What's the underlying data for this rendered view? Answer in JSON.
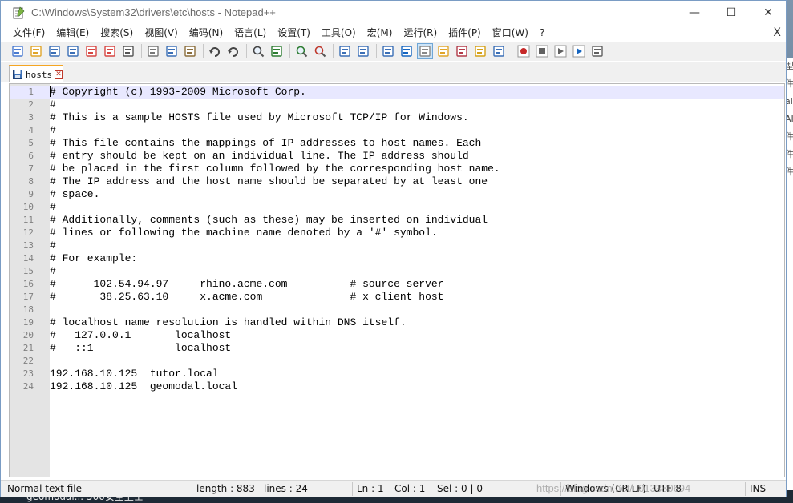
{
  "window": {
    "title": "C:\\Windows\\System32\\drivers\\etc\\hosts - Notepad++",
    "minimize_glyph": "—",
    "maximize_glyph": "☐",
    "close_glyph": "✕"
  },
  "menu": {
    "items": [
      {
        "label": "文件(F)"
      },
      {
        "label": "编辑(E)"
      },
      {
        "label": "搜索(S)"
      },
      {
        "label": "视图(V)"
      },
      {
        "label": "编码(N)"
      },
      {
        "label": "语言(L)"
      },
      {
        "label": "设置(T)"
      },
      {
        "label": "工具(O)"
      },
      {
        "label": "宏(M)"
      },
      {
        "label": "运行(R)"
      },
      {
        "label": "插件(P)"
      },
      {
        "label": "窗口(W)"
      },
      {
        "label": "?"
      }
    ],
    "close_label": "X"
  },
  "toolbar": {
    "icons": [
      "new-file-icon",
      "open-file-icon",
      "save-icon",
      "save-all-icon",
      "close-icon",
      "close-all-icon",
      "print-icon",
      "cut-icon",
      "copy-icon",
      "paste-icon",
      "undo-icon",
      "redo-icon",
      "find-icon",
      "replace-icon",
      "zoom-in-icon",
      "zoom-out-icon",
      "sync-vertical-icon",
      "sync-horizontal-icon",
      "word-wrap-icon",
      "show-all-characters-icon",
      "indent-guide-icon",
      "document-map-icon",
      "function-list-icon",
      "folder-as-workspace-icon",
      "monitoring-icon",
      "record-macro-icon",
      "stop-macro-icon",
      "play-macro-icon",
      "play-macro-multiple-icon",
      "save-macro-icon"
    ]
  },
  "tab": {
    "label": "hosts",
    "close_glyph": "✕"
  },
  "editor": {
    "lines": [
      "# Copyright (c) 1993-2009 Microsoft Corp.",
      "#",
      "# This is a sample HOSTS file used by Microsoft TCP/IP for Windows.",
      "#",
      "# This file contains the mappings of IP addresses to host names. Each",
      "# entry should be kept on an individual line. The IP address should",
      "# be placed in the first column followed by the corresponding host name.",
      "# The IP address and the host name should be separated by at least one",
      "# space.",
      "#",
      "# Additionally, comments (such as these) may be inserted on individual",
      "# lines or following the machine name denoted by a '#' symbol.",
      "#",
      "# For example:",
      "#",
      "#      102.54.94.97     rhino.acme.com          # source server",
      "#       38.25.63.10     x.acme.com              # x client host",
      "",
      "# localhost name resolution is handled within DNS itself.",
      "#   127.0.0.1       localhost",
      "#   ::1             localhost",
      "",
      "192.168.10.125  tutor.local",
      "192.168.10.125  geomodal.local"
    ]
  },
  "status": {
    "file_type": "Normal text file",
    "length": "length : 883",
    "lines": "lines : 24",
    "ln": "Ln : 1",
    "col": "Col : 1",
    "sel": "Sel : 0 | 0",
    "eol": "Windows (CR LF)",
    "encoding": "UTF-8",
    "mode": "INS"
  },
  "background": {
    "taskbar_text": "geomodal... 500安全卫士",
    "side_chars": [
      "型",
      "件",
      "al",
      "AI",
      "件",
      "件",
      "件"
    ],
    "watermark": "https://blog.csdn.net/u013380694"
  }
}
